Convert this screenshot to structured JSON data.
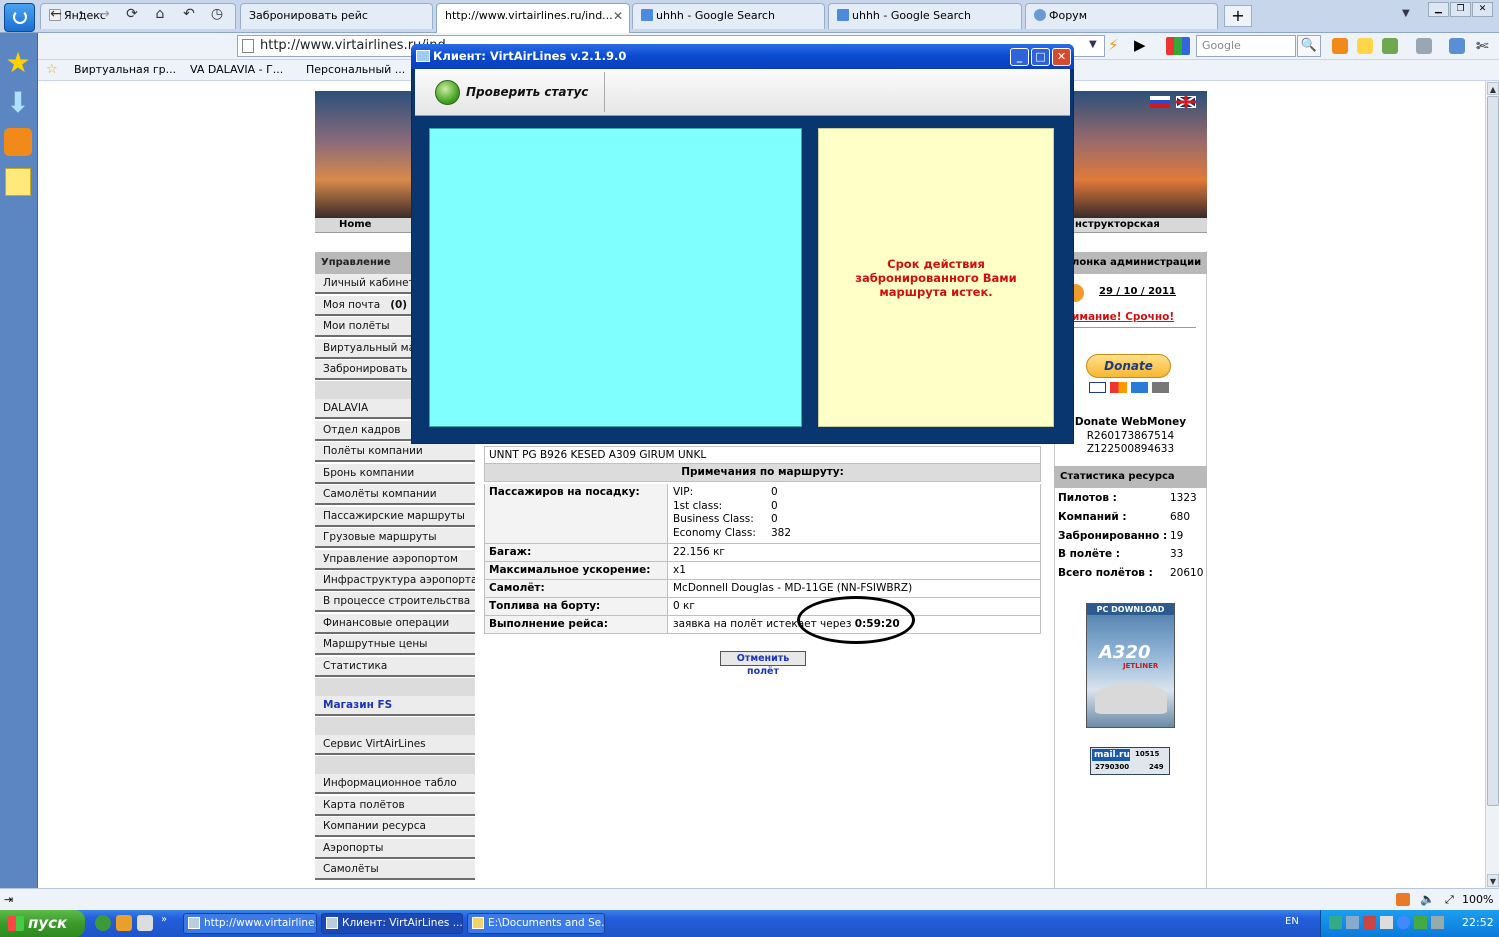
{
  "browser": {
    "tabs": [
      {
        "label": "Яндекс"
      },
      {
        "label": "Забронировать рейс"
      },
      {
        "label": "http://www.virtairlines.ru/ind..."
      },
      {
        "label": "uhhh - Google Search"
      },
      {
        "label": "uhhh - Google Search"
      },
      {
        "label": "Форум"
      }
    ],
    "new_tab": "+",
    "url": "http://www.virtairlines.ru/ind",
    "search_placeholder": "Google",
    "bookmarks": [
      "Виртуальная гр...",
      "VA DALAVIA - Г...",
      "Персональный ..."
    ],
    "zoom": "100%"
  },
  "site": {
    "menubar_left": "Home",
    "menubar_right": "нструкторская",
    "left_menu": {
      "header": "Управление",
      "group1": [
        "Личный кабинет",
        "Моя почта",
        "Мои полёты",
        "Виртуальный ма",
        "Забронировать р"
      ],
      "mail_count": "(0)",
      "group2": [
        "DALAVIA",
        "Отдел кадров",
        "Полёты компании",
        "Бронь компании",
        "Самолёты компании",
        "Пассажирские маршруты",
        "Грузовые маршруты",
        "Управление аэропортом",
        "Инфраструктура аэропорта",
        "В процессе строительства",
        "Финансовые операции",
        "Маршрутные цены",
        "Статистика"
      ],
      "shop": "Магазин FS",
      "service": "Сервис VirtAirLines",
      "group3": [
        "Информационное табло",
        "Карта полётов",
        "Компании ресурса",
        "Аэропорты",
        "Самолёты"
      ]
    },
    "flight": {
      "route": "UNNT PG B926 KESED A309 GIRUM UNKL",
      "notes_header": "Примечания по маршруту:",
      "passengers_label": "Пассажиров на посадку:",
      "passenger_classes": [
        {
          "name": "VIP:",
          "count": "0"
        },
        {
          "name": "1st class:",
          "count": "0"
        },
        {
          "name": "Business Class:",
          "count": "0"
        },
        {
          "name": "Economy Class:",
          "count": "382"
        }
      ],
      "baggage_label": "Багаж:",
      "baggage": "22.156 кг",
      "accel_label": "Максимальное ускорение:",
      "accel": "x1",
      "aircraft_label": "Самолёт:",
      "aircraft": "McDonnell Douglas - MD-11GE (NN-FSIWBRZ)",
      "fuel_label": "Топлива на борту:",
      "fuel": "0 кг",
      "exec_label": "Выполнение рейса:",
      "exec_text": "заявка на полёт истекает через",
      "exec_time": "0:59:20",
      "cancel": "Отменить полёт"
    },
    "right": {
      "admin_header": "лонка администрации",
      "date": "29 / 10 / 2011",
      "urgent": "имание! Срочно!",
      "donate": "Donate",
      "wm_title": "Donate WebMoney",
      "wm_r": "R260173867514",
      "wm_z": "Z122500894633",
      "stats_header": "Статистика ресурса",
      "stats": [
        {
          "k": "Пилотов :",
          "v": "1323"
        },
        {
          "k": "Компаний :",
          "v": "680"
        },
        {
          "k": "Забронированно :",
          "v": "19"
        },
        {
          "k": "В полёте :",
          "v": "33"
        },
        {
          "k": "Всего полётов :",
          "v": "20610"
        }
      ],
      "ad_top": "PC DOWNLOAD",
      "ad_title": "A320",
      "ad_sub": "JETLINER",
      "mailru": "mail.ru",
      "mailru_n1": "10515",
      "mailru_n2": "2790300",
      "mailru_n3": "249"
    }
  },
  "dialog": {
    "title": "Клиент: VirtAirLines   v.2.1.9.0",
    "check_status": "Проверить статус",
    "message_lines": [
      "Срок действия",
      "забронированного Вами",
      "маршрута истек."
    ]
  },
  "taskbar": {
    "start": "пуск",
    "tasks": [
      "http://www.virtairline...",
      "Клиент: VirtAirLines ...",
      "E:\\Documents and Se..."
    ],
    "lang": "EN",
    "clock": "22:52"
  },
  "colors": {
    "dialog_bg": "#0a3670",
    "cyan_panel": "#80ffff",
    "yellow_panel": "#ffffc8",
    "message": "#d01010"
  }
}
